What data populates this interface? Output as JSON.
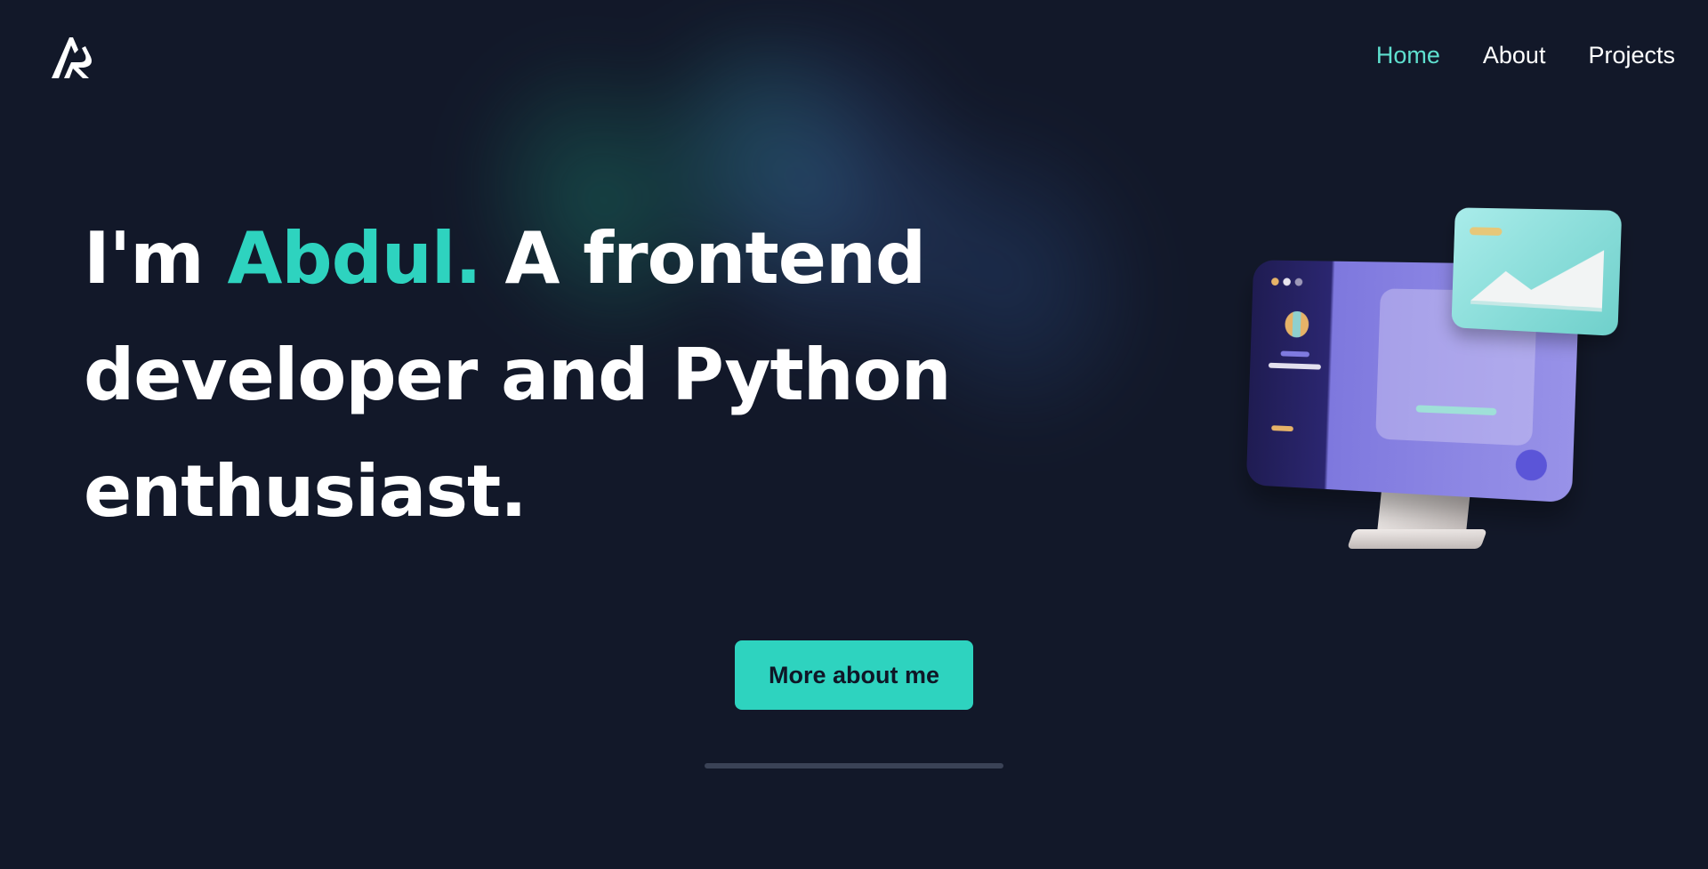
{
  "nav": {
    "logo_alt": "AR",
    "links": [
      {
        "label": "Home",
        "active": true
      },
      {
        "label": "About",
        "active": false
      },
      {
        "label": "Projects",
        "active": false
      }
    ]
  },
  "hero": {
    "prefix": "I'm ",
    "name": "Abdul.",
    "line_rest": " A frontend",
    "line2": "developer and Python",
    "line3": "enthusiast.",
    "cta_label": "More about me"
  },
  "illustration": {
    "icon": "monitor-illustration"
  },
  "colors": {
    "background": "#121829",
    "accent": "#2ed3bf",
    "nav_active": "#5fe0cf",
    "text": "#ffffff"
  }
}
